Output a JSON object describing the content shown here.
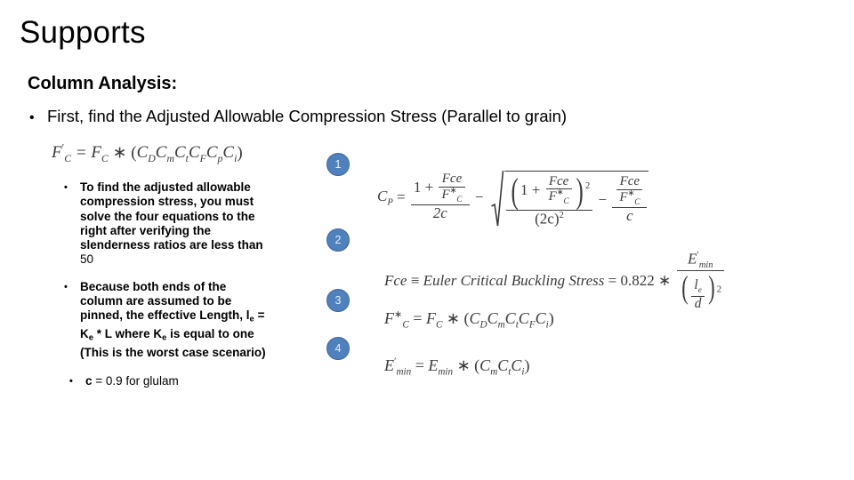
{
  "slide": {
    "title": "Supports",
    "heading": "Column Analysis:",
    "main_bullet": {
      "marker": "•",
      "text": "First, find the Adjusted Allowable Compression Stress (Parallel to grain)"
    },
    "left_equation": {
      "name": "adjusted-allowable-compression-stress",
      "plain": "F'C = FC * (CD Cm Ct CF Cp Ci)",
      "lhs": "F",
      "lhs_prime": "′",
      "lhs_sub": "C",
      "equals": "=",
      "rhs_base": "F",
      "rhs_base_sub": "C",
      "times": "∗",
      "factors": [
        "C",
        "C",
        "C",
        "C",
        "C",
        "C"
      ],
      "factor_subs": [
        "D",
        "m",
        "t",
        "F",
        "p",
        "i"
      ],
      "open_paren": "(",
      "close_paren": ")"
    },
    "sub_bullets": [
      {
        "marker": "•",
        "text": "To find the adjusted allowable compression stress, you must solve the four equations to the right after verifying the slenderness ratios are less than ",
        "trailing_number": "50"
      },
      {
        "marker": "•",
        "parts": [
          "Because both ends of the column are assumed to be pinned, the effective Length, l",
          "e",
          " = K",
          "e",
          " * L where K",
          "e",
          " is equal to one (This is the worst case scenario)"
        ]
      },
      {
        "marker": "•",
        "text": "c = 0.9 for glulam",
        "lead": "c",
        "rest": " = 0.9 for glulam"
      }
    ],
    "badges": [
      {
        "label": "1",
        "name": "equation-badge-1"
      },
      {
        "label": "2",
        "name": "equation-badge-2"
      },
      {
        "label": "3",
        "name": "equation-badge-3"
      },
      {
        "label": "4",
        "name": "equation-badge-4"
      }
    ],
    "equations": [
      {
        "id": 1,
        "name": "column-stability-factor",
        "plain": "CP = (1 + Fce/F*C)/(2c) - sqrt( ((1 + Fce/F*C)^2)/((2c)^2) - (Fce/F*C)/c )",
        "lhs": "C",
        "lhs_sub": "P",
        "equals": "=",
        "numerator_one": "1",
        "plus": "+",
        "fce": "Fce",
        "fstar_base": "F",
        "fstar_sup": "∗",
        "fstar_sub": "C",
        "denominator_2c": "2c",
        "minus": "−",
        "sq_exp": "2",
        "den_2c_sq": "(2c)",
        "den_2c_sq_exp": "2",
        "tail_den": "c"
      },
      {
        "id": 2,
        "name": "euler-critical-buckling-stress",
        "plain": "Fce = Euler Critical Buckling Stress = 0.822 * E'min / (le/d)^2",
        "lhs": "Fce",
        "identity": "≡",
        "words": "Euler Critical Buckling Stress",
        "equals": "=",
        "coefficient": "0.822",
        "times": "∗",
        "e_base": "E",
        "e_prime": "′",
        "e_sub": "min",
        "slender_num": "l",
        "slender_num_sub": "e",
        "slender_den": "d",
        "exp": "2"
      },
      {
        "id": 3,
        "name": "reference-compression-design-value",
        "plain": "F*C = FC * (CD Cm Ct CF Ci)",
        "lhs_base": "F",
        "lhs_sup": "∗",
        "lhs_sub": "C",
        "equals": "=",
        "rhs_base": "F",
        "rhs_sub": "C",
        "times": "∗",
        "open_paren": "(",
        "close_paren": ")",
        "factors": [
          "C",
          "C",
          "C",
          "C",
          "C"
        ],
        "factor_subs": [
          "D",
          "m",
          "t",
          "F",
          "i"
        ]
      },
      {
        "id": 4,
        "name": "adjusted-minimum-modulus-of-elasticity",
        "plain": "E'min = Emin * (Cm Ct Ci)",
        "lhs_base": "E",
        "lhs_prime": "′",
        "lhs_sub": "min",
        "equals": "=",
        "rhs_base": "E",
        "rhs_sub": "min",
        "times": "∗",
        "open_paren": "(",
        "close_paren": ")",
        "factors": [
          "C",
          "C",
          "C"
        ],
        "factor_subs": [
          "m",
          "t",
          "i"
        ]
      }
    ],
    "colors": {
      "badge_fill": "#4f81bd",
      "badge_border": "#3f6694",
      "badge_text": "#e9f0f8",
      "text": "#000000",
      "math_text": "#3a3a3a",
      "background": "#ffffff"
    }
  }
}
